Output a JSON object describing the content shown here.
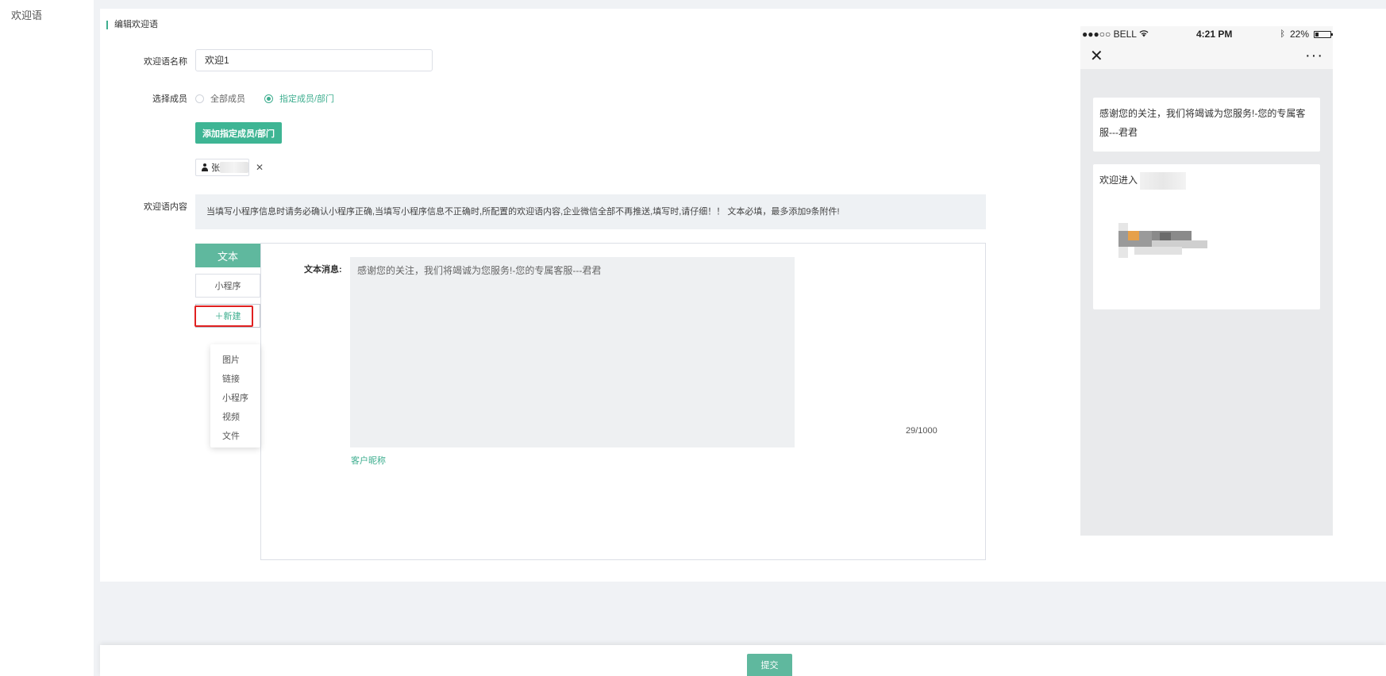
{
  "nav": {
    "item": "欢迎语"
  },
  "form": {
    "section_title": "编辑欢迎语",
    "name_label": "欢迎语名称",
    "name_value": "欢迎1",
    "member_label": "选择成员",
    "radio_all": "全部成员",
    "radio_specific": "指定成员/部门",
    "add_member_button": "添加指定成员/部门",
    "member_tag_prefix": "张",
    "content_label": "欢迎语内容",
    "notice": "当填写小程序信息时请务必确认小程序正确,当填写小程序信息不正确时,所配置的欢迎语内容,企业微信全部不再推送,填写时,请仔细！！ 文本必填，最多添加9条附件!"
  },
  "tabs": {
    "text": "文本",
    "miniprogram": "小程序",
    "new": "＋新建"
  },
  "dropdown": [
    "图片",
    "链接",
    "小程序",
    "视频",
    "文件"
  ],
  "editor": {
    "label": "文本消息:",
    "text": "感谢您的关注，我们将竭诚为您服务!-您的专属客服---君君",
    "counter": "29/1000",
    "nickname_link": "客户昵称"
  },
  "phone": {
    "carrier": "●●●○○ BELL",
    "time": "4:21 PM",
    "battery": "22%",
    "message1": "感谢您的关注，我们将竭诚为您服务!-您的专属客服---君君",
    "message2": "欢迎进入"
  },
  "footer": {
    "submit": "提交"
  }
}
